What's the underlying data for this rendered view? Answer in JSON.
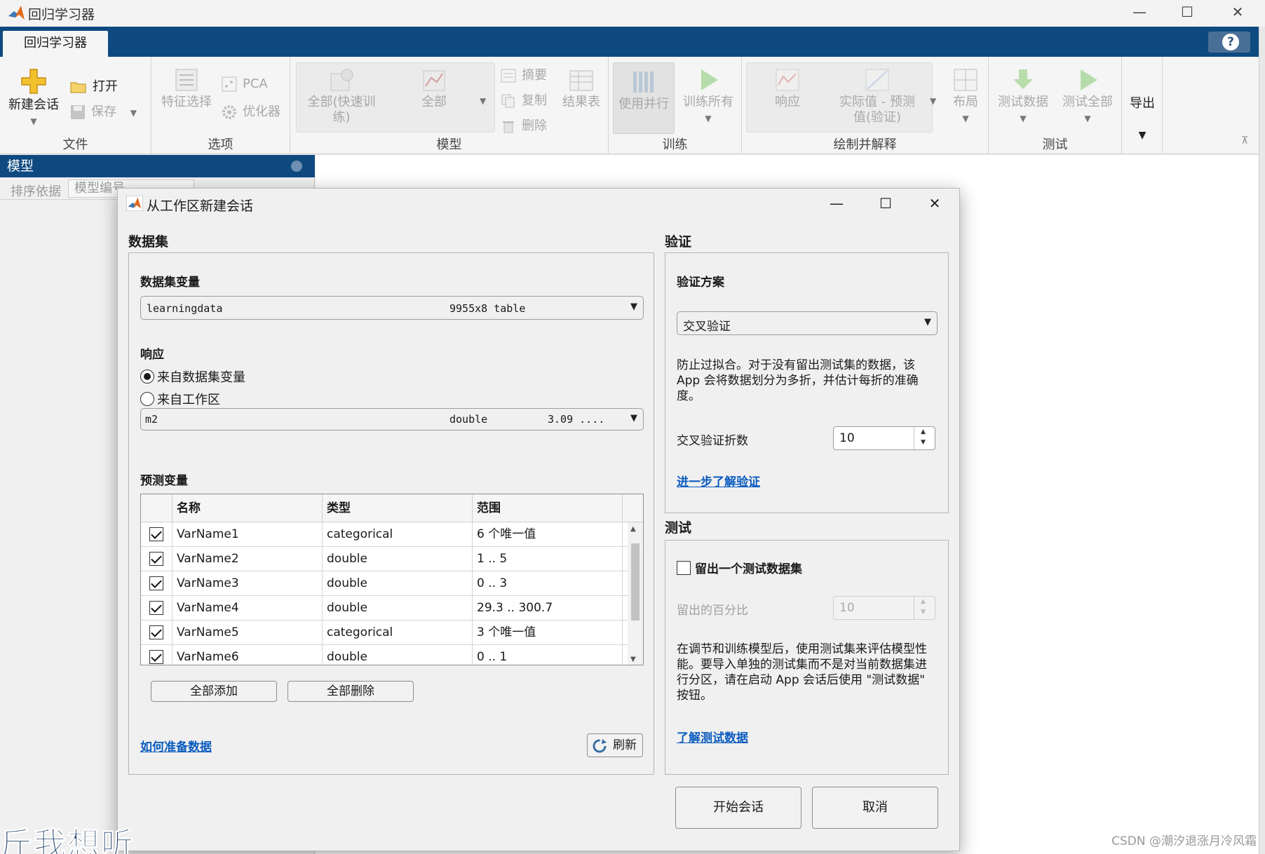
{
  "window": {
    "title": "回归学习器"
  },
  "tabs": {
    "active": "回归学习器",
    "help": "?"
  },
  "ribbon": {
    "file": {
      "label": "文件",
      "new_session": "新建会话",
      "open": "打开",
      "save": "保存"
    },
    "options": {
      "label": "选项",
      "feature_selection": "特征选择",
      "pca": "PCA",
      "optimizer": "优化器"
    },
    "models": {
      "label": "模型",
      "all_quick_line1": "全部(快速训",
      "all_quick_line2": "练)",
      "all": "全部",
      "summary": "摘要",
      "copy": "复制",
      "delete": "删除",
      "results_table": "结果表"
    },
    "train": {
      "label": "训练",
      "use_parallel": "使用并行",
      "train_all": "训练所有"
    },
    "plot": {
      "label": "绘制并解释",
      "response": "响应",
      "pred_vs_actual_line1": "实际值 - 预测",
      "pred_vs_actual_line2": "值(验证)",
      "layout": "布局"
    },
    "test": {
      "label": "测试",
      "test_data": "测试数据",
      "test_all": "测试全部"
    },
    "export": {
      "label": "导出"
    }
  },
  "models_pane": {
    "title": "模型",
    "sort_label": "排序依据",
    "sort_value": "模型编号"
  },
  "dialog": {
    "title": "从工作区新建会话",
    "dataset": {
      "section": "数据集",
      "var_label": "数据集变量",
      "var_name": "learningdata",
      "var_info": "9955x8  table",
      "response_label": "响应",
      "radio_from_dataset": "来自数据集变量",
      "radio_from_workspace": "来自工作区",
      "response_name": "m2",
      "response_type": "double",
      "response_range": "3.09 ....",
      "predictors_label": "预测变量",
      "columns": [
        "名称",
        "类型",
        "范围"
      ],
      "rows": [
        {
          "name": "VarName1",
          "type": "categorical",
          "range": "6 个唯一值",
          "checked": true
        },
        {
          "name": "VarName2",
          "type": "double",
          "range": "1 .. 5",
          "checked": true
        },
        {
          "name": "VarName3",
          "type": "double",
          "range": "0 .. 3",
          "checked": true
        },
        {
          "name": "VarName4",
          "type": "double",
          "range": "29.3 .. 300.7",
          "checked": true
        },
        {
          "name": "VarName5",
          "type": "categorical",
          "range": "3 个唯一值",
          "checked": true
        },
        {
          "name": "VarName6",
          "type": "double",
          "range": "0 .. 1",
          "checked": true
        }
      ],
      "add_all": "全部添加",
      "remove_all": "全部删除",
      "how_to_link": "如何准备数据",
      "refresh": "刷新"
    },
    "validation": {
      "section": "验证",
      "scheme_label": "验证方案",
      "scheme_value": "交叉验证",
      "description": "防止过拟合。对于没有留出测试集的数据，该 App 会将数据划分为多折，并估计每折的准确度。",
      "folds_label": "交叉验证折数",
      "folds_value": "10",
      "learn_more": "进一步了解验证"
    },
    "test": {
      "section": "测试",
      "holdout_checkbox": "留出一个测试数据集",
      "percent_label": "留出的百分比",
      "percent_value": "10",
      "description": "在调节和训练模型后，使用测试集来评估模型性能。要导入单独的测试集而不是对当前数据集进行分区，请在启动 App 会话后使用 \"测试数据\" 按钮。",
      "learn_more": "了解测试数据"
    },
    "start_button": "开始会话",
    "cancel_button": "取消"
  },
  "watermark": "CSDN @潮汐退涨月冷风霜",
  "overlay_text": "斤我想听"
}
